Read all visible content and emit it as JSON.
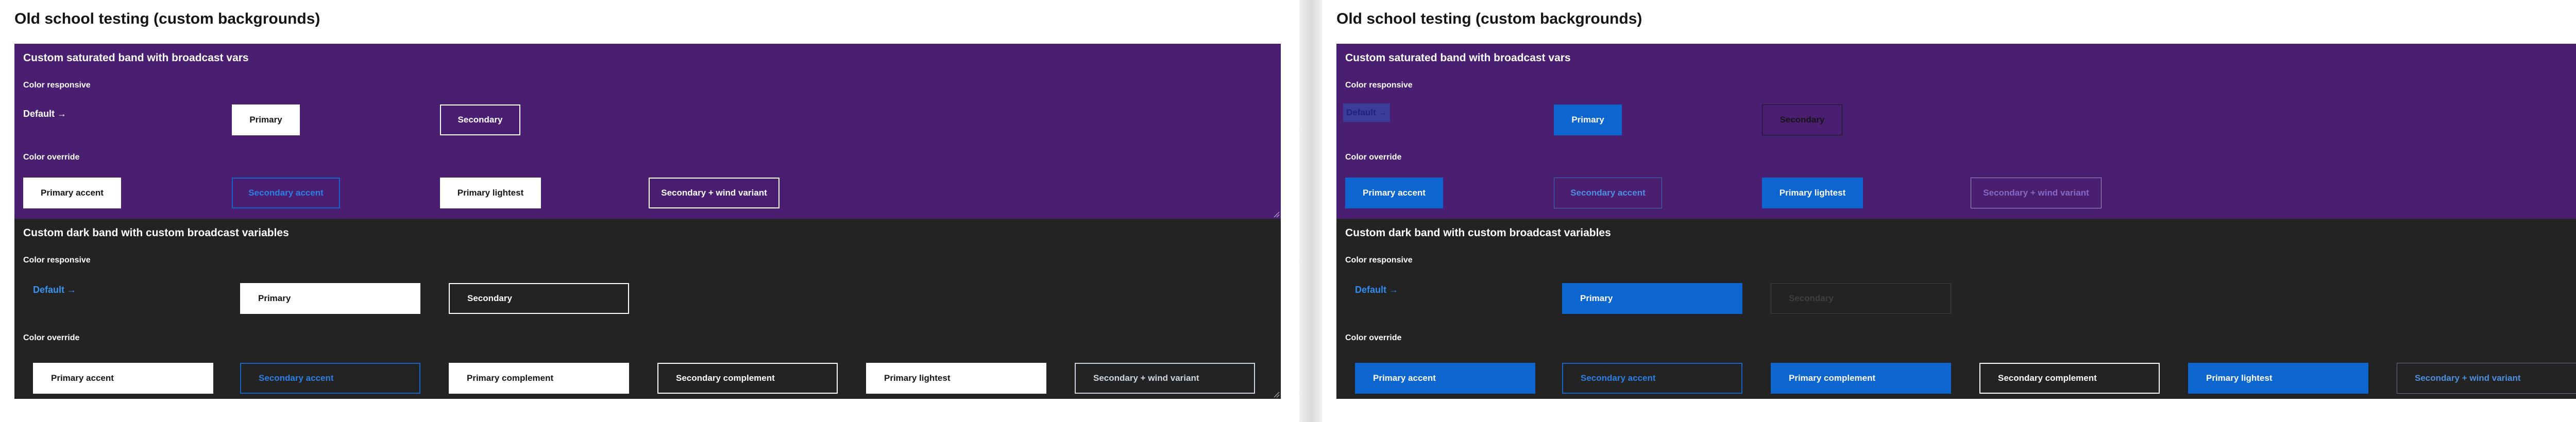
{
  "left": {
    "page_title": "Old school testing (custom backgrounds)",
    "purple_band": {
      "title": "Custom saturated band with broadcast vars",
      "responsive_label": "Color responsive",
      "default_link": "Default →",
      "primary": "Primary",
      "secondary": "Secondary",
      "override_label": "Color override",
      "primary_accent": "Primary accent",
      "secondary_accent": "Secondary accent",
      "primary_lightest": "Primary lightest",
      "secondary_wind": "Secondary + wind variant"
    },
    "dark_band": {
      "title": "Custom dark band with custom broadcast variables",
      "responsive_label": "Color responsive",
      "default_link": "Default →",
      "primary": "Primary",
      "secondary": "Secondary",
      "override_label": "Color override",
      "primary_accent": "Primary accent",
      "secondary_accent": "Secondary accent",
      "primary_complement": "Primary complement",
      "secondary_complement": "Secondary complement",
      "primary_lightest": "Primary lightest",
      "secondary_wind": "Secondary + wind variant"
    }
  },
  "right": {
    "page_title": "Old school testing (custom backgrounds)",
    "purple_band": {
      "title": "Custom saturated band with broadcast vars",
      "responsive_label": "Color responsive",
      "default_link": "Default →",
      "primary": "Primary",
      "secondary": "Secondary",
      "override_label": "Color override",
      "primary_accent": "Primary accent",
      "secondary_accent": "Secondary accent",
      "primary_lightest": "Primary lightest",
      "secondary_wind": "Secondary + wind variant"
    },
    "dark_band": {
      "title": "Custom dark band with custom broadcast variables",
      "responsive_label": "Color responsive",
      "default_link": "Default →",
      "primary": "Primary",
      "secondary": "Secondary",
      "override_label": "Color override",
      "primary_accent": "Primary accent",
      "secondary_accent": "Secondary accent",
      "primary_complement": "Primary complement",
      "secondary_complement": "Secondary complement",
      "primary_lightest": "Primary lightest",
      "secondary_wind": "Secondary + wind variant"
    }
  },
  "colors": {
    "purple_band": "#4a1f72",
    "dark_band": "#232323",
    "blue_button": "#0d66d0",
    "link_blue": "#3c92ef"
  }
}
